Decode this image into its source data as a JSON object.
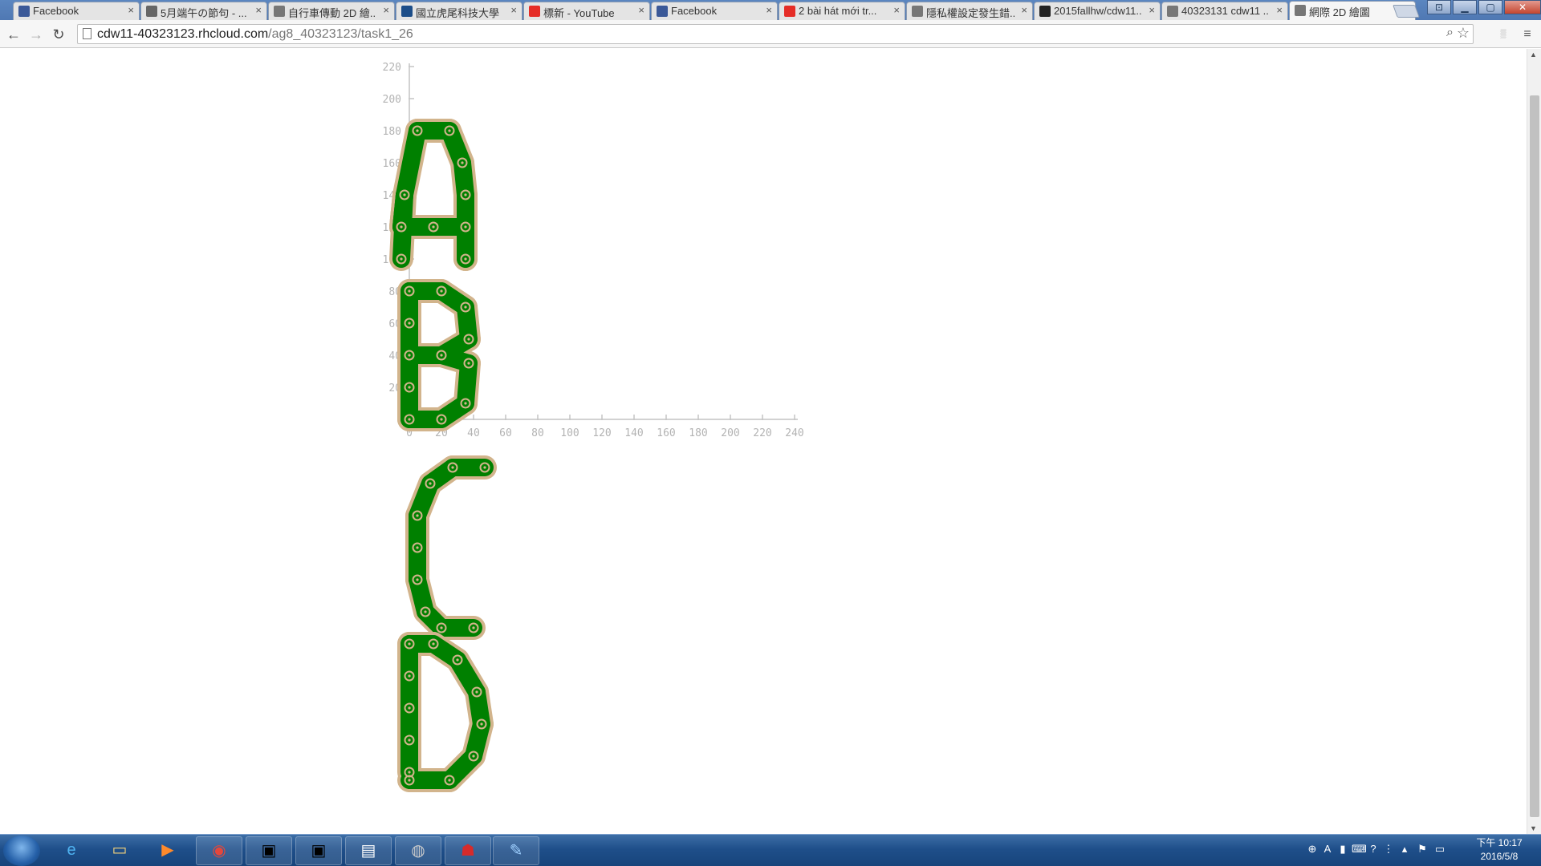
{
  "browser": {
    "tabs": [
      {
        "title": "Facebook",
        "icon": "facebook-icon",
        "icon_color": "#3b5998",
        "active": false
      },
      {
        "title": "5月端午の節句 - ...",
        "icon": "avatar-icon",
        "icon_color": "#666666",
        "active": false
      },
      {
        "title": "自行車傳動 2D 繪...",
        "icon": "page-icon",
        "icon_color": "#777777",
        "active": false
      },
      {
        "title": "國立虎尾科技大學",
        "icon": "nfu-icon",
        "icon_color": "#1d4e89",
        "active": false
      },
      {
        "title": "標新 - YouTube",
        "icon": "youtube-icon",
        "icon_color": "#e52d27",
        "active": false
      },
      {
        "title": "Facebook",
        "icon": "facebook-icon",
        "icon_color": "#3b5998",
        "active": false
      },
      {
        "title": "2 bài hát mới tr...",
        "icon": "youtube-icon",
        "icon_color": "#e52d27",
        "active": false,
        "audio": true
      },
      {
        "title": "隱私權設定發生錯...",
        "icon": "page-icon",
        "icon_color": "#777777",
        "active": false
      },
      {
        "title": "2015fallhw/cdw11...",
        "icon": "github-icon",
        "icon_color": "#222222",
        "active": false
      },
      {
        "title": "40323131 cdw11 ...",
        "icon": "page-icon",
        "icon_color": "#777777",
        "active": false
      },
      {
        "title": "網際 2D 繪圖",
        "icon": "page-icon",
        "icon_color": "#777777",
        "active": true
      }
    ],
    "tab_close_glyph": "×",
    "url_host": "cdw11-40323123.rhcloud.com",
    "url_path": "/ag8_40323123/task1_26",
    "zoom_icon": "zoom-icon",
    "star_icon": "bookmark-star-icon",
    "menu_icon": "hamburger-menu-icon"
  },
  "chart_data": {
    "type": "scatter",
    "title": "",
    "xlabel": "",
    "ylabel": "",
    "x_ticks": [
      0,
      20,
      40,
      60,
      80,
      100,
      120,
      140,
      160,
      180,
      200,
      220,
      240
    ],
    "y_ticks": [
      20,
      40,
      60,
      80,
      100,
      120,
      140,
      160,
      180,
      200,
      220
    ],
    "xlim": [
      0,
      240
    ],
    "ylim": [
      0,
      220
    ],
    "grid": false,
    "link_color": "#008000",
    "link_outline_color": "#d2b48c",
    "pin_color": "#d2b48c",
    "series": [
      {
        "name": "A",
        "closed": false,
        "points": [
          [
            -5,
            100
          ],
          [
            -3,
            140
          ],
          [
            -5,
            120
          ],
          [
            -3,
            140
          ],
          [
            5,
            180
          ],
          [
            25,
            180
          ],
          [
            33,
            160
          ],
          [
            35,
            140
          ],
          [
            35,
            120
          ],
          [
            35,
            100
          ],
          [
            35,
            120
          ],
          [
            15,
            120
          ],
          [
            -5,
            120
          ]
        ]
      },
      {
        "name": "B",
        "closed": false,
        "points": [
          [
            0,
            0
          ],
          [
            0,
            20
          ],
          [
            0,
            40
          ],
          [
            0,
            60
          ],
          [
            0,
            80
          ],
          [
            20,
            80
          ],
          [
            35,
            70
          ],
          [
            37,
            50
          ],
          [
            20,
            40
          ],
          [
            0,
            40
          ],
          [
            20,
            40
          ],
          [
            37,
            35
          ],
          [
            35,
            10
          ],
          [
            20,
            0
          ],
          [
            0,
            0
          ]
        ]
      },
      {
        "name": "C",
        "closed": false,
        "points": [
          [
            47,
            -30
          ],
          [
            27,
            -30
          ],
          [
            13,
            -40
          ],
          [
            5,
            -60
          ],
          [
            5,
            -80
          ],
          [
            5,
            -100
          ],
          [
            10,
            -120
          ],
          [
            20,
            -130
          ],
          [
            40,
            -130
          ]
        ]
      },
      {
        "name": "D",
        "closed": false,
        "points": [
          [
            0,
            -220
          ],
          [
            0,
            -200
          ],
          [
            0,
            -180
          ],
          [
            0,
            -160
          ],
          [
            0,
            -140
          ],
          [
            15,
            -140
          ],
          [
            30,
            -150
          ],
          [
            42,
            -170
          ],
          [
            45,
            -190
          ],
          [
            40,
            -210
          ],
          [
            25,
            -225
          ],
          [
            0,
            -225
          ]
        ]
      }
    ]
  },
  "taskbar": {
    "apps": [
      {
        "name": "ie-icon",
        "glyph": "e",
        "color": "#4fb3f1"
      },
      {
        "name": "file-explorer-icon",
        "glyph": "▭",
        "color": "#f4d27a"
      },
      {
        "name": "media-player-icon",
        "glyph": "▶",
        "color": "#ff8a2b"
      },
      {
        "name": "chrome-icon",
        "glyph": "◉",
        "color": "#e5473b"
      },
      {
        "name": "cmd-icon",
        "glyph": "▣",
        "color": "#000000"
      },
      {
        "name": "cmd-icon-2",
        "glyph": "▣",
        "color": "#000000"
      },
      {
        "name": "notepad-icon",
        "glyph": "▤",
        "color": "#ffffff"
      },
      {
        "name": "sphere-app-icon",
        "glyph": "◍",
        "color": "#cccccc"
      },
      {
        "name": "game-app-icon",
        "glyph": "☗",
        "color": "#d62b2b"
      },
      {
        "name": "paint-icon",
        "glyph": "✎",
        "color": "#9fd0ff"
      }
    ],
    "clock_time": "下午 10:17",
    "clock_date": "2016/5/8"
  }
}
